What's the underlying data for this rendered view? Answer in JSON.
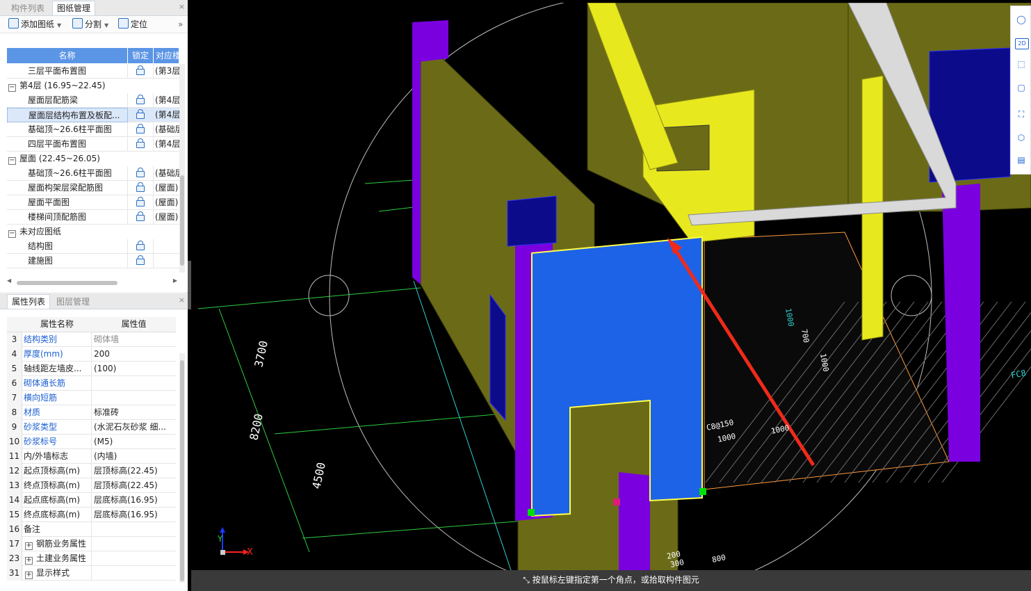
{
  "drawing_panel": {
    "tabs": [
      "构件列表",
      "图纸管理"
    ],
    "close": "×",
    "toolbar": {
      "add": "添加图纸",
      "split": "分割",
      "locate": "定位",
      "more": "»"
    },
    "columns": [
      "名称",
      "锁定",
      "对应楼"
    ],
    "rows": [
      {
        "type": "item",
        "name": "三层平面布置图",
        "map": "(第3层"
      },
      {
        "type": "group",
        "name": "第4层 (16.95~22.45)",
        "toggle": "−"
      },
      {
        "type": "item",
        "name": "屋面层配筋梁",
        "map": "(第4层"
      },
      {
        "type": "item",
        "name": "屋面层结构布置及板配...",
        "map": "(第4层",
        "selected": true
      },
      {
        "type": "item",
        "name": "基础顶~26.6柱平面图",
        "map": "(基础层"
      },
      {
        "type": "item",
        "name": "四层平面布置图",
        "map": "(第4层"
      },
      {
        "type": "group",
        "name": "屋面 (22.45~26.05)",
        "toggle": "−"
      },
      {
        "type": "item",
        "name": "基础顶~26.6柱平面图",
        "map": "(基础层"
      },
      {
        "type": "item",
        "name": "屋面构架层梁配筋图",
        "map": "(屋面)"
      },
      {
        "type": "item",
        "name": "屋面平面图",
        "map": "(屋面)"
      },
      {
        "type": "item",
        "name": "楼梯间顶配筋图",
        "map": "(屋面)"
      },
      {
        "type": "group",
        "name": "未对应图纸",
        "toggle": "−"
      },
      {
        "type": "item",
        "name": "结构图",
        "map": ""
      },
      {
        "type": "item",
        "name": "建施图",
        "map": ""
      }
    ]
  },
  "property_panel": {
    "tabs": [
      "属性列表",
      "图层管理"
    ],
    "close": "×",
    "columns": [
      "属性名称",
      "属性值"
    ],
    "rows": [
      {
        "num": "3",
        "name": "结构类别",
        "value": "砌体墙",
        "blue": true,
        "gray": true
      },
      {
        "num": "4",
        "name": "厚度(mm)",
        "value": "200",
        "blue": true
      },
      {
        "num": "5",
        "name": "轴线距左墙皮...",
        "value": "(100)"
      },
      {
        "num": "6",
        "name": "砌体通长筋",
        "value": "",
        "blue": true
      },
      {
        "num": "7",
        "name": "横向短筋",
        "value": "",
        "blue": true
      },
      {
        "num": "8",
        "name": "材质",
        "value": "标准砖",
        "blue": true
      },
      {
        "num": "9",
        "name": "砂浆类型",
        "value": "(水泥石灰砂浆 细...",
        "blue": true
      },
      {
        "num": "10",
        "name": "砂浆标号",
        "value": "(M5)",
        "blue": true
      },
      {
        "num": "11",
        "name": "内/外墙标志",
        "value": "(内墙)"
      },
      {
        "num": "12",
        "name": "起点顶标高(m)",
        "value": "层顶标高(22.45)"
      },
      {
        "num": "13",
        "name": "终点顶标高(m)",
        "value": "层顶标高(22.45)"
      },
      {
        "num": "14",
        "name": "起点底标高(m)",
        "value": "层底标高(16.95)"
      },
      {
        "num": "15",
        "name": "终点底标高(m)",
        "value": "层底标高(16.95)"
      },
      {
        "num": "16",
        "name": "备注",
        "value": ""
      },
      {
        "num": "17",
        "name": "钢筋业务属性",
        "value": "",
        "expand": "+"
      },
      {
        "num": "23",
        "name": "土建业务属性",
        "value": "",
        "expand": "+"
      },
      {
        "num": "31",
        "name": "显示样式",
        "value": "",
        "expand": "+"
      }
    ]
  },
  "viewport": {
    "dims": [
      "3700",
      "8200",
      "4500"
    ],
    "annotations": [
      "C8@150",
      "1000",
      "1000",
      "700",
      "1000",
      "1000",
      "FC8",
      "200",
      "300",
      "800"
    ],
    "axis_labels": [
      "Y",
      "X"
    ],
    "colors": {
      "wall": "#6b6b17",
      "wall_yellow": "#e8e81f",
      "column": "#7a00e0",
      "selected_wall": "#1d63e8",
      "beam": "#d9d9d9",
      "window": "#0c0c8a",
      "dim_line": "#2ecc40",
      "arrow": "#f02a1a"
    },
    "right_tools": [
      "orbit-icon",
      "2d-icon",
      "3d-box-icon",
      "box-icon",
      "fullscreen-icon",
      "view-cube-icon",
      "notes-icon"
    ]
  },
  "status_bar": {
    "text": "按鼠标左键指定第一个角点，或拾取构件图元"
  }
}
